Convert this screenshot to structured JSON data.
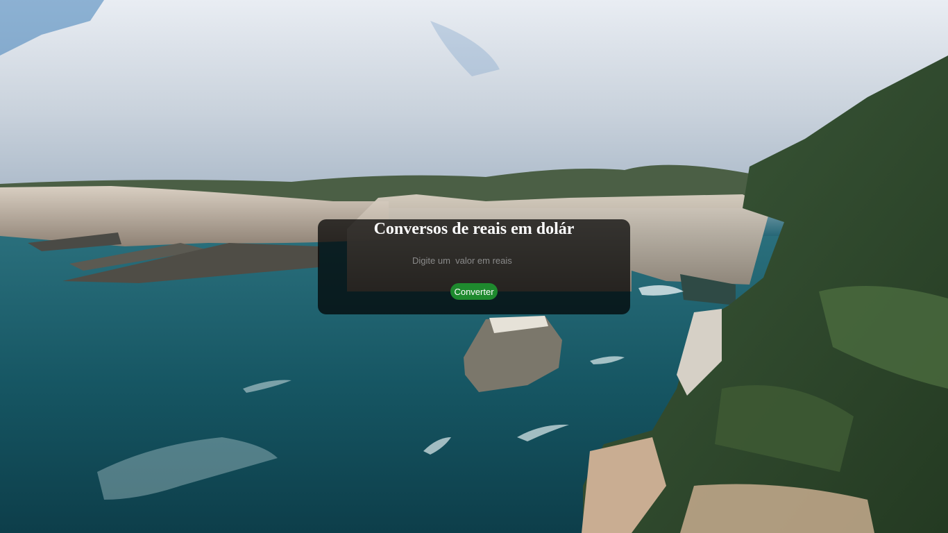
{
  "converter": {
    "title": "Conversos de reais em dolár",
    "input_placeholder": "Digite um  valor em reais",
    "input_value": "",
    "button_label": "Converter"
  },
  "colors": {
    "card_background": "#000000",
    "button": "#1e8a2e",
    "text": "#ffffff"
  }
}
